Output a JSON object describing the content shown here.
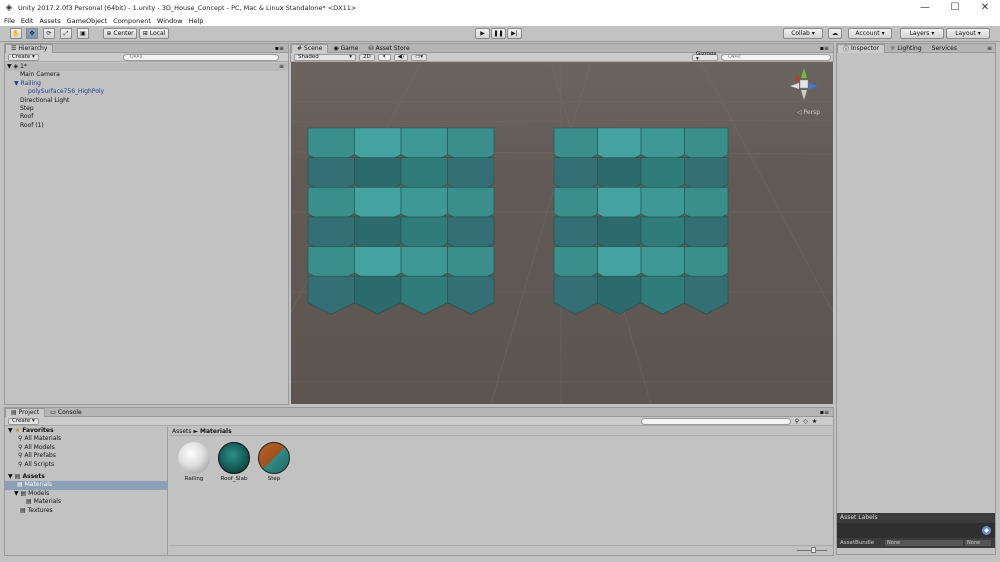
{
  "window": {
    "title": "Unity 2017.2.0f3 Personal (64bit) - 1.unity - 3D_House_Concept - PC, Mac & Linux Standalone* <DX11>",
    "min": "—",
    "max": "☐",
    "close": "✕"
  },
  "menu": [
    "File",
    "Edit",
    "Assets",
    "GameObject",
    "Component",
    "Window",
    "Help"
  ],
  "toolbar": {
    "center": "Center",
    "local": "Local",
    "collab": "Collab ▾",
    "account": "Account",
    "layers": "Layers",
    "layout": "Layout"
  },
  "hierarchy": {
    "tab": "Hierarchy",
    "create": "Create ▾",
    "search_placeholder": "Q▾All",
    "scene": "1*",
    "items": [
      "Main Camera",
      "Railing",
      "polySurface756_HighPoly",
      "Directional Light",
      "Step",
      "Roof",
      "Roof (1)"
    ]
  },
  "scene_tabs": {
    "scene": "Scene",
    "game": "Game",
    "asset_store": "Asset Store",
    "shaded": "Shaded",
    "mode2d": "2D",
    "gizmos": "Gizmos ▾",
    "search_placeholder": "Q▾All",
    "persp": "◁ Persp"
  },
  "inspector": {
    "tabs": [
      "Inspector",
      "Lighting",
      "Services"
    ],
    "asset_labels": "Asset Labels",
    "asset_bundle": "AssetBundle",
    "bundle_value": "None",
    "bundle_variant": "None"
  },
  "project": {
    "tabs": [
      "Project",
      "Console"
    ],
    "create": "Create ▾",
    "favorites": "Favorites",
    "favorite_items": [
      "All Materials",
      "All Models",
      "All Prefabs",
      "All Scripts"
    ],
    "assets": "Assets",
    "asset_tree": [
      "Materials",
      "Models",
      "Materials",
      "Textures"
    ],
    "breadcrumb_root": "Assets",
    "breadcrumb_sep": "►",
    "breadcrumb_leaf": "Materials",
    "materials": [
      "Railing",
      "Roof_Slab",
      "Step"
    ]
  }
}
